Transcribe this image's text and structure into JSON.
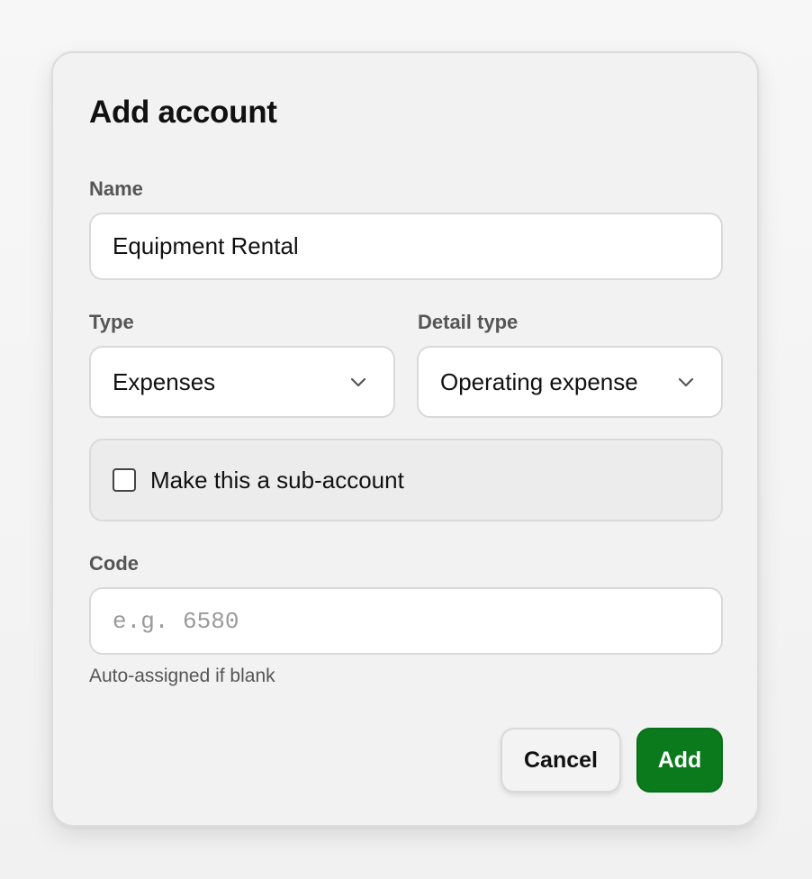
{
  "dialog": {
    "title": "Add account"
  },
  "name": {
    "label": "Name",
    "value": "Equipment Rental"
  },
  "type": {
    "label": "Type",
    "value": "Expenses",
    "icon": "chevron-down-icon"
  },
  "detail_type": {
    "label": "Detail type",
    "value": "Operating expense",
    "icon": "chevron-down-icon"
  },
  "sub_account": {
    "label": "Make this a sub-account",
    "checked": false
  },
  "code": {
    "label": "Code",
    "placeholder": "e.g. 6580",
    "value": "",
    "hint": "Auto-assigned if blank"
  },
  "actions": {
    "cancel_label": "Cancel",
    "add_label": "Add"
  },
  "colors": {
    "primary": "#0a7a1c",
    "panel": "#f2f2f2",
    "border": "#d9d9d9"
  }
}
